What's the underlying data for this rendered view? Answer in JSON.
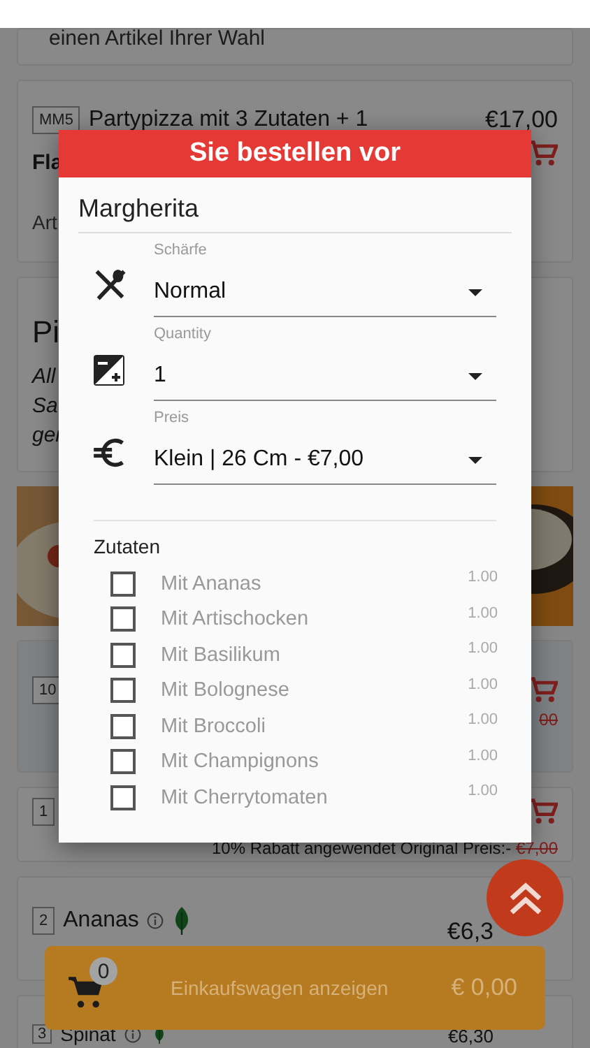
{
  "menu": {
    "cards": [
      {
        "kind": "note",
        "text": "einen Artikel Ihrer Wahl"
      },
      {
        "kind": "item",
        "code": "MM5",
        "title": "Partypizza mit 3 Zutaten + 1",
        "subtitle": "Fla",
        "price": "€17,00",
        "note": "Art",
        "cart": true
      },
      {
        "kind": "category",
        "title": "Pi",
        "lines": [
          "All",
          "Sa",
          "ger"
        ]
      },
      {
        "kind": "picture"
      },
      {
        "kind": "item",
        "code": "10",
        "old_price": "00",
        "cart": true,
        "highlight": true
      },
      {
        "kind": "item",
        "code": "1",
        "cart": true,
        "discount": "10% Rabatt angewendet Original Preis:-",
        "old_price": "€7,00"
      },
      {
        "kind": "item",
        "code": "2",
        "title": "Ananas",
        "info": true,
        "veggie": true,
        "price": "€6,3"
      },
      {
        "kind": "item",
        "code": "3",
        "title": "Spinat",
        "info": true,
        "veggie": true,
        "price": "€6,30"
      }
    ]
  },
  "dialog": {
    "title": "Sie bestellen vor",
    "product": "Margherita",
    "fields": [
      {
        "kind": "spice",
        "label": "Schärfe",
        "value": "Normal"
      },
      {
        "kind": "quantity",
        "label": "Quantity",
        "value": "1"
      },
      {
        "kind": "price",
        "label": "Preis",
        "value": "Klein | 26 Cm - €7,00"
      }
    ],
    "toppings_title": "Zutaten",
    "toppings": [
      {
        "name": "Mit Ananas",
        "price": "1.00",
        "checked": false
      },
      {
        "name": "Mit Artischocken",
        "price": "1.00",
        "checked": false
      },
      {
        "name": "Mit Basilikum",
        "price": "1.00",
        "checked": false
      },
      {
        "name": "Mit Bolognese",
        "price": "1.00",
        "checked": false
      },
      {
        "name": "Mit Broccoli",
        "price": "1.00",
        "checked": false
      },
      {
        "name": "Mit Champignons",
        "price": "1.00",
        "checked": false
      },
      {
        "name": "Mit Cherrytomaten",
        "price": "1.00",
        "checked": false
      }
    ]
  },
  "cart_bar": {
    "count": "0",
    "label": "Einkaufswagen anzeigen",
    "total": "€ 0,00"
  }
}
